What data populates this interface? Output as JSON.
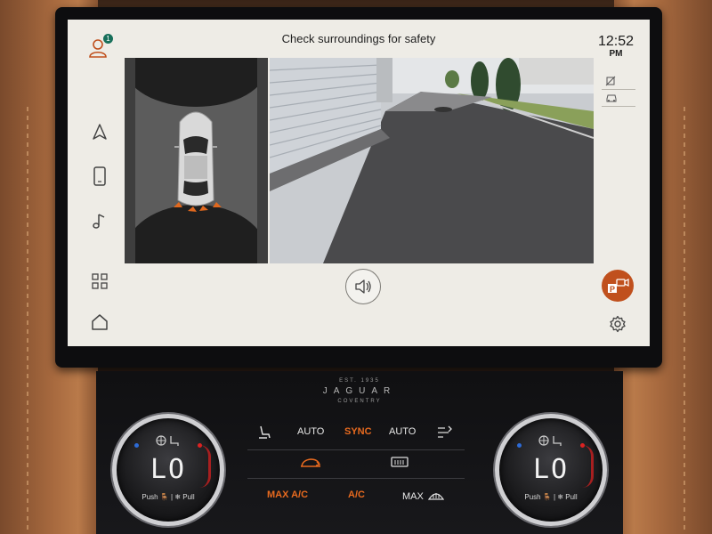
{
  "screen": {
    "title": "Check surroundings for safety",
    "notification_count": "1",
    "clock": {
      "time": "12:52",
      "ampm": "PM"
    }
  },
  "nav_icons": [
    "navigation-icon",
    "phone-icon",
    "media-icon",
    "apps-grid-icon",
    "home-icon"
  ],
  "colors": {
    "accent_orange": "#C0501D",
    "badge_green": "#176F5A",
    "screen_bg": "#EEECE6",
    "climate_orange": "#E86A1F"
  },
  "brand": {
    "est": "EST. 1935",
    "name": "JAGUAR",
    "sub": "COVENTRY"
  },
  "climate": {
    "left_temp": "LO",
    "right_temp": "LO",
    "left_hint": "Push 🪑 | ❄ Pull",
    "right_hint": "Push 🪑 | ❄ Pull",
    "row1": [
      "AUTO",
      "SYNC",
      "AUTO"
    ],
    "row3": [
      "MAX A/C",
      "A/C",
      "MAX"
    ]
  }
}
